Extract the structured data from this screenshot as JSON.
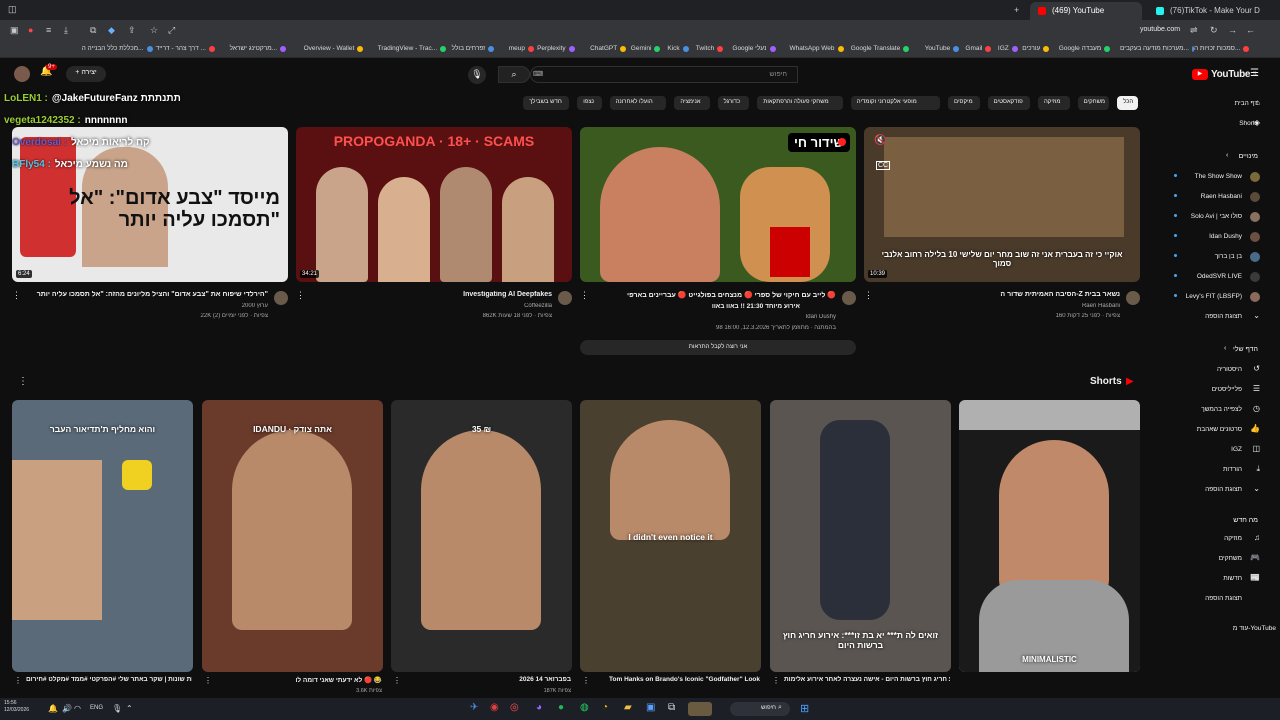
{
  "browser": {
    "tabs": [
      {
        "label": "(469) YouTube",
        "active": true,
        "favicon_color": "#ff0000"
      },
      {
        "label": "(76)TikTok - Make Your Day",
        "active": false,
        "favicon_color": "#25f4ee"
      }
    ],
    "address": "youtube.com",
    "bookmarks": [
      "סמכות זכויות ה...",
      "מערכות מודעה בעקבים...",
      "Google מעבדה",
      "עורכים",
      "IGZ",
      "Gmail",
      "YouTube",
      "Google Translate",
      "WhatsApp Web",
      "Google נעלי",
      "Twitch",
      "Kick",
      "Gemini",
      "ChatGPT",
      "Perplexity",
      "meup",
      "זפרחים בולל",
      "TradingView - Trac...",
      "Overview - Wallet",
      "מרקטינג ישראל...",
      "דרך צהר - דרייד ...",
      "מכללת כלל הבנייה ה..."
    ]
  },
  "yt": {
    "logo": "YouTube",
    "logo_region": "IL",
    "search_placeholder": "חיפוש",
    "create_label": "יצירה",
    "notifications_count": "9+",
    "chips": [
      "הכל",
      "משחקים",
      "מוזיקה",
      "פודקאסטים",
      "מיקסים",
      "מופעי אלקטרוני וקומדיה",
      "משחקי פעולה והרפתקאות",
      "כדורגל",
      "אנימציה",
      "הועלו לאחרונה",
      "נצפו",
      "חדש בשבילך"
    ]
  },
  "sidebar": {
    "home": "דף הבית",
    "shorts": "Shorts",
    "subs_header": "מינויים",
    "subs": [
      "The Show Show",
      "Raen Hasbani",
      "Solo Avi | סולו אבי",
      "Idan Dushy",
      "בן בן ברוך",
      "OdedSVR LIVE",
      "Levy's FIT (LBSFP)"
    ],
    "show_more": "תצוגת הוספה",
    "you_header": "הדף שלי",
    "you_items": [
      "היסטוריה",
      "פלייליסטים",
      "לצפייה בהמשך",
      "סרטונים שאהבת",
      "IGZ",
      "הורדות"
    ],
    "show_more2": "תצוגת הוספה",
    "explore_header": "מה חדש",
    "explore_items": [
      "מוזיקה",
      "משחקים",
      "חדשות"
    ],
    "show_more3": "תצוגת הוספה",
    "more_from": "עוד מ-YouTube"
  },
  "chat": [
    {
      "user": "LoLEN1 :",
      "msg": "@JakeFutureFanz תתנתתת",
      "color": "#9acd32"
    },
    {
      "user": "vegeta1242352 :",
      "msg": "nnnnnnn",
      "color": "#9acd32"
    },
    {
      "user": "Overdosai :",
      "msg": "קח לריאות מיכאל",
      "color": "#6a5acd"
    },
    {
      "user": "BFly54 :",
      "msg": "מה נשמע מיכאל",
      "color": "#5bc0de"
    }
  ],
  "videos": [
    {
      "title": "הירלדי שיפוח את \"צבע אדום\" והציל מליונים מהזה: \"אל תסמכו עליה יותר\"",
      "channel": "ערוץ 2000",
      "meta": "22K צפיות · לפני יומיים (2)",
      "duration": "6:24",
      "thumb_text": "מייסד \"צבע אדום\": \"אל תסמכו עליה יותר\"",
      "thumb_color": "#e9e9e9"
    },
    {
      "title": "Investigating AI Deepfakes",
      "channel": "Coffeezilla",
      "meta": "862K צפיות · לפני 18 שעות",
      "duration": "34:21",
      "thumb_text": "PROPOGANDA · 18+ · SCAMS",
      "thumb_color": "#5a1010"
    },
    {
      "title": "לייב עם חיקוי של ספרי 🔴 מנצחים בפולגייט 🔴 עבריינים בארפי 🔴",
      "channel": "Idan Dushy",
      "meta": "98 בהמתנה · מתוזמן לתאריך 12.3.2026, 16:00",
      "duration": "",
      "live_badge": "שידור חי",
      "extra": "אירוע מיוחד 21:30 !! באוו באוו",
      "thumb_color": "#3a5a20"
    },
    {
      "title": "הסיבה האמיתית שדור ה-Z נשאר בבית",
      "channel": "Raen Hasbani",
      "meta": "160 צפיות · לפני 25 דקות",
      "duration": "10:39",
      "thumb_text": "אוקיי כי זה בעברית אני זה שוב מחר יום שלישי 10 בלילה רחוב אלנבי סמוך",
      "thumb_color": "#4a3a2a"
    }
  ],
  "notify_banner": "אני רוצה לקבל התראות",
  "shorts_header": "Shorts",
  "shorts": [
    {
      "title": "מגזרים פרקטים למגל\" ושריה בשרות שונות | שקר באתר שלי #הפרקטי #ממד #מקלט #חירום",
      "meta": "",
      "overlay": "והוא מחליף ת'תדיאור העבר",
      "color": "#5a6a78"
    },
    {
      "title": "לא ידעתי שאני דומה לו 🔴 😂",
      "meta": "3.6K צפיות",
      "overlay": "IDANDU · אתה צודק",
      "color": "#6a3a2a"
    },
    {
      "title": "2026 בפברואר 14",
      "meta": "187K צפיות",
      "overlay": "35 ₪",
      "color": "#2a2a2a"
    },
    {
      "title": "Tom Hanks on Brando's Iconic \"Godfather\" Look",
      "meta": "",
      "overlay": "I didn't even notice it",
      "color": "#4a4030"
    },
    {
      "title": "לא בת זו*** יא בת זו***: אירוע חריג חוץ ברשות היום - אישה נעצרה לאחר אירוע אלימות",
      "meta": "",
      "overlay": "זואים לה ת*** יא בת זו***: אירוע חריג חוץ ברשות היום",
      "color": "#5a5550"
    },
    {
      "title": "",
      "meta": "",
      "overlay": "MINIMALISTIC",
      "color": "#b0b0b0"
    }
  ],
  "taskbar": {
    "time": "15:56",
    "date": "12/03/2026",
    "lang": "ENG",
    "search": "חיפוש"
  },
  "colors": {
    "accent": "#ff0000",
    "bg": "#0f0f0f",
    "live": "#cc0000"
  }
}
